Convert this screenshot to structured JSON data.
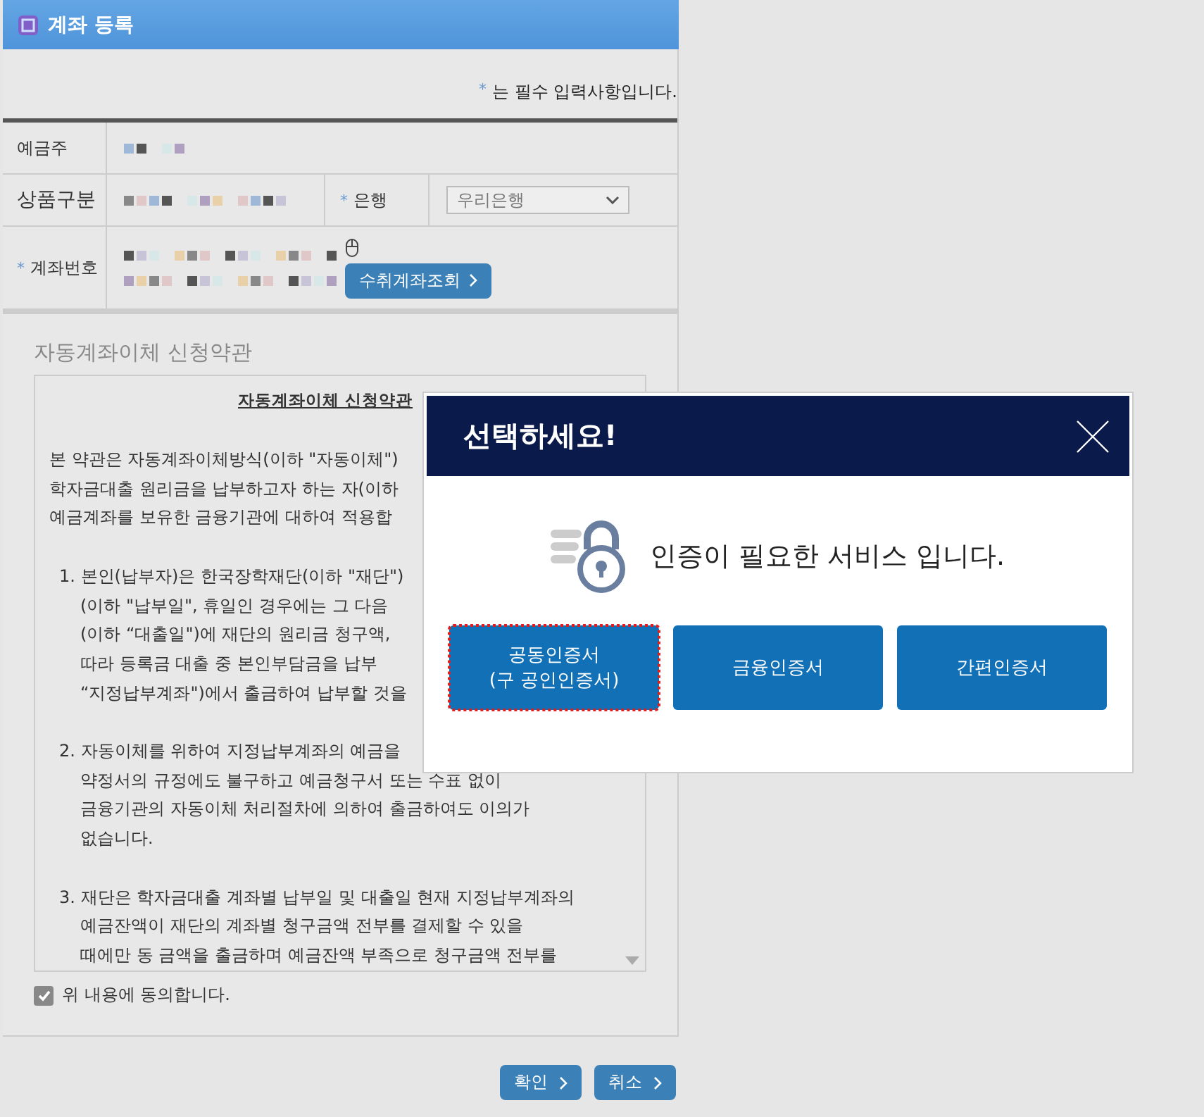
{
  "window": {
    "title": "계좌 등록"
  },
  "required_note": {
    "mark": "*",
    "text": "는 필수 입력사항입니다."
  },
  "form": {
    "depositor": {
      "label": "예금주",
      "required": false
    },
    "product": {
      "label": "상품구분",
      "required": false
    },
    "bank": {
      "label": "은행",
      "required": true,
      "value": "우리은행"
    },
    "account": {
      "label": "계좌번호",
      "required": true,
      "button": "수취계좌조회"
    }
  },
  "terms": {
    "heading": "자동계좌이체 신청약관",
    "title": "자동계좌이체 신청약관",
    "blocks": [
      {
        "lines": [
          "본 약관은 자동계좌이체방식(이하 \"자동이체\")",
          "학자금대출 원리금을 납부하고자 하는 자(이하",
          "예금계좌를 보유한 금융기관에 대하여 적용합"
        ]
      },
      {
        "number": "1.",
        "lines": [
          "본인(납부자)은 한국장학재단(이하 \"재단\")",
          "(이하 \"납부일\", 휴일인 경우에는 그 다음",
          "(이하 “대출일\")에 재단의 원리금 청구액,",
          "따라 등록금 대출 중 본인부담금을 납부",
          "“지정납부계좌\")에서 출금하여 납부할 것을"
        ]
      },
      {
        "number": "2.",
        "lines": [
          "자동이체를 위하여 지정납부계좌의 예금을",
          "약정서의 규정에도 불구하고 예금청구서 또는 수표 없이",
          "금융기관의 자동이체 처리절차에 의하여 출금하여도 이의가",
          "없습니다."
        ]
      },
      {
        "number": "3.",
        "lines": [
          "재단은 학자금대출 계좌별 납부일 및 대출일 현재 지정납부계좌의",
          "예금잔액이 재단의 계좌별 청구금액 전부를 결제할 수 있을",
          "때에만 동 금액을 출금하며 예금잔액 부족으로 청구금액 전부를"
        ]
      }
    ],
    "agree": {
      "label": "위 내용에 동의합니다.",
      "checked": true
    }
  },
  "buttons": [
    {
      "label": "확인"
    },
    {
      "label": "취소"
    }
  ],
  "modal": {
    "title": "선택하세요!",
    "message": "인증이 필요한 서비스 입니다.",
    "options": [
      {
        "label": "공동인증서\n(구 공인인증서)",
        "focused": true
      },
      {
        "label": "금융인증서",
        "focused": false
      },
      {
        "label": "간편인증서",
        "focused": false
      }
    ]
  }
}
